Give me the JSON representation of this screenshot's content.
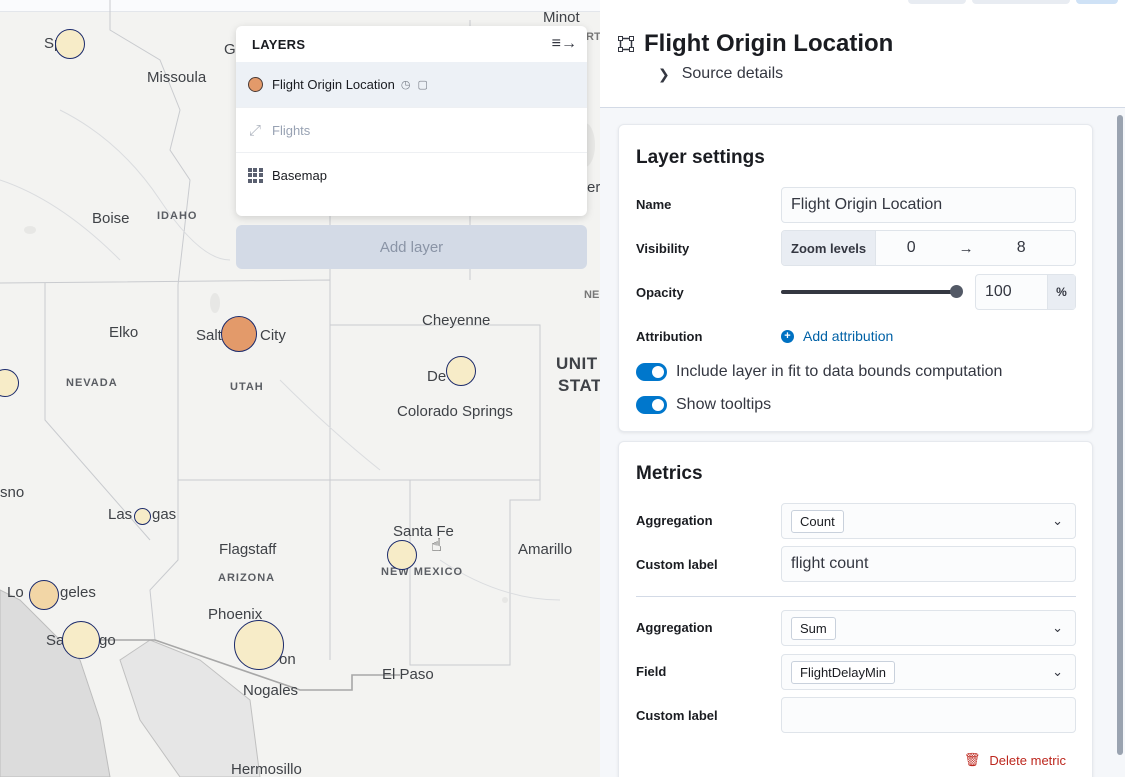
{
  "map": {
    "labels": {
      "minot": "Minot",
      "spokane": "Sp      ne",
      "missoula": "Missoula",
      "boise": "Boise",
      "idaho": "IDAHO",
      "elko": "Elko",
      "slc_a": "Salt",
      "slc_b": "City",
      "cheyenne": "Cheyenne",
      "ne": "NE",
      "united": "UNIT",
      "states": "STAT",
      "nevada": "NEVADA",
      "utah": "UTAH",
      "denver": "De",
      "colorado_springs": "Colorado Springs",
      "fresno": "sno",
      "las_vegas_a": "Las",
      "las_vegas_b": "gas",
      "flagstaff": "Flagstaff",
      "santa_fe": "Santa Fe",
      "amarillo": "Amarillo",
      "arizona": "ARIZONA",
      "new_mexico": "NEW MEXICO",
      "los_angeles_a": "Lo",
      "los_angeles_b": "geles",
      "phoenix": "Phoenix",
      "san_diego_a": "Sa",
      "san_diego_b": "go",
      "tucson": "on",
      "el_paso": "El Paso",
      "nogales": "Nogales",
      "hermosillo": "Hermosillo",
      "g_edge": "G",
      "rt_edge": "RT",
      "er_edge": "er"
    }
  },
  "layers_panel": {
    "title": "LAYERS",
    "collapse_icon": "collapse-icon",
    "items": [
      {
        "label": "Flight Origin Location",
        "icon": "circle-swatch",
        "extra": "◷ ▢"
      },
      {
        "label": "Flights",
        "icon": "line-icon"
      },
      {
        "label": "Basemap",
        "icon": "grid-icon"
      }
    ],
    "add_button": "Add layer"
  },
  "editor": {
    "title": "Flight Origin Location",
    "source_details": "Source details",
    "layer_settings": {
      "heading": "Layer settings",
      "name_label": "Name",
      "name_value": "Flight Origin Location",
      "visibility_label": "Visibility",
      "zoom_prefix": "Zoom levels",
      "zoom_min": "0",
      "zoom_arrow": "→",
      "zoom_max": "8",
      "opacity_label": "Opacity",
      "opacity_value": "100",
      "opacity_unit": "%",
      "opacity_fraction": 1.0,
      "attribution_label": "Attribution",
      "add_attribution": "Add attribution",
      "toggle_fit": "Include layer in fit to data bounds computation",
      "toggle_tooltips": "Show tooltips"
    },
    "metrics": {
      "heading": "Metrics",
      "items": [
        {
          "aggregation_label": "Aggregation",
          "aggregation": "Count",
          "custom_label_label": "Custom label",
          "custom_label": "flight count"
        },
        {
          "aggregation_label": "Aggregation",
          "aggregation": "Sum",
          "field_label": "Field",
          "field": "FlightDelayMin",
          "custom_label_label": "Custom label",
          "custom_label": ""
        }
      ],
      "delete_metric": "Delete metric"
    }
  },
  "colors": {
    "accent": "#0077cc",
    "danger": "#bd271e",
    "bubble_light": "#f7ecc8",
    "bubble_dark": "#e39a6a"
  }
}
